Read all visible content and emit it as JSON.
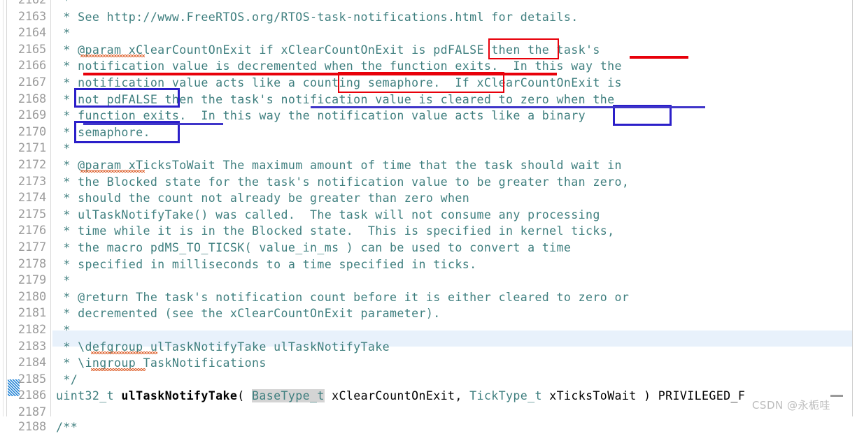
{
  "editor": {
    "language": "c",
    "file_kind": "FreeRTOS task.h source",
    "colors": {
      "comment": "#3f7f7f",
      "line_number": "#9b9b9b",
      "current_line_highlight": "#e8f1fb",
      "occurrence_highlight": "#d4d4d4",
      "annotation_red": "#e8000a",
      "annotation_blue": "#2b1fc9",
      "gutter_marker_blue": "#1a7fd4",
      "background": "#ffffff",
      "spellcheck_squiggle": "#e06c3c"
    },
    "gutter_marker_line": "2186",
    "current_line": "2183"
  },
  "lines": [
    {
      "no": "2162",
      "text": " *",
      "partial_top": true
    },
    {
      "no": "2163",
      "text": " * See http://www.FreeRTOS.org/RTOS-task-notifications.html for details."
    },
    {
      "no": "2164",
      "text": " *"
    },
    {
      "no": "2165",
      "text": " * @param xClearCountOnExit if xClearCountOnExit is pdFALSE then the task's"
    },
    {
      "no": "2166",
      "text": " * notification value is decremented when the function exits.  In this way the"
    },
    {
      "no": "2167",
      "text": " * notification value acts like a counting semaphore.  If xClearCountOnExit is"
    },
    {
      "no": "2168",
      "text": " * not pdFALSE then the task's notification value is cleared to zero when the"
    },
    {
      "no": "2169",
      "text": " * function exits.  In this way the notification value acts like a binary"
    },
    {
      "no": "2170",
      "text": " * semaphore."
    },
    {
      "no": "2171",
      "text": " *"
    },
    {
      "no": "2172",
      "text": " * @param xTicksToWait The maximum amount of time that the task should wait in"
    },
    {
      "no": "2173",
      "text": " * the Blocked state for the task's notification value to be greater than zero,"
    },
    {
      "no": "2174",
      "text": " * should the count not already be greater than zero when"
    },
    {
      "no": "2175",
      "text": " * ulTaskNotifyTake() was called.  The task will not consume any processing"
    },
    {
      "no": "2176",
      "text": " * time while it is in the Blocked state.  This is specified in kernel ticks,"
    },
    {
      "no": "2177",
      "text": " * the macro pdMS_TO_TICSK( value_in_ms ) can be used to convert a time"
    },
    {
      "no": "2178",
      "text": " * specified in milliseconds to a time specified in ticks."
    },
    {
      "no": "2179",
      "text": " *"
    },
    {
      "no": "2180",
      "text": " * @return The task's notification count before it is either cleared to zero or"
    },
    {
      "no": "2181",
      "text": " * decremented (see the xClearCountOnExit parameter)."
    },
    {
      "no": "2182",
      "text": " *"
    },
    {
      "no": "2183",
      "text": " * \\defgroup ulTaskNotifyTake ulTaskNotifyTake",
      "highlighted": true
    },
    {
      "no": "2184",
      "text": " * \\ingroup TaskNotifications"
    },
    {
      "no": "2185",
      "text": " */"
    },
    {
      "no": "2186",
      "text": "uint32_t ulTaskNotifyTake( BaseType_t xClearCountOnExit, TickType_t xTicksToWait ) PRIVILEGED_F",
      "is_declaration": true
    },
    {
      "no": "2187",
      "text": ""
    },
    {
      "no": "2188",
      "text": "/**",
      "partial_bottom": true
    }
  ],
  "declaration": {
    "return_type": "uint32_t",
    "function_name": "ulTaskNotifyTake",
    "open_paren": "( ",
    "param1_type": "BaseType_t",
    "param1_name": " xClearCountOnExit, ",
    "param2_type": "TickType_t",
    "param2_name": " xTicksToWait ",
    "close_paren": ") ",
    "suffix": "PRIVILEGED_F"
  },
  "annotations": {
    "red_boxes": [
      {
        "label": "pdFALSE",
        "line": "2165"
      },
      {
        "label": "counting semaphore.",
        "line": "2167"
      }
    ],
    "blue_boxes": [
      {
        "label": "not pdFALSE",
        "line": "2168"
      },
      {
        "label": "binary",
        "line": "2169"
      },
      {
        "label": "semaphore.",
        "line": "2170"
      }
    ],
    "red_underlines": [
      {
        "label": "task's",
        "line": "2165"
      },
      {
        "label": "notification value is decremented when the function exits.",
        "line": "2166"
      }
    ],
    "blue_underlines": [
      {
        "label": "notification value is cleared to zero when the",
        "line": "2168"
      },
      {
        "label": "function exits.",
        "line": "2169"
      }
    ]
  },
  "watermark": {
    "text": "CSDN @永栀哇"
  }
}
